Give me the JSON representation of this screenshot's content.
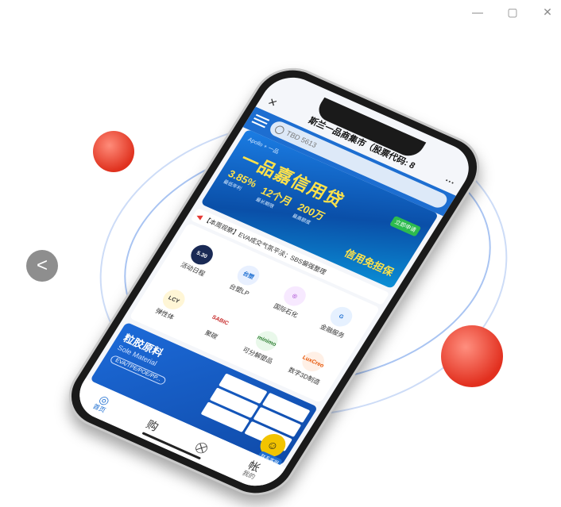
{
  "window": {
    "minimize": "—",
    "maximize": "▢",
    "close": "✕"
  },
  "carousel": {
    "prev_label": "<"
  },
  "app": {
    "title": "斯兰一品商集市（股票代码: 8",
    "close": "✕",
    "more": "···",
    "search_placeholder": "TBD 5613",
    "banner": {
      "small": "Apollo + 一品",
      "title": "一品嘉信用贷",
      "tag": "立即申请",
      "rates": [
        {
          "value": "3.85%",
          "caption": "最低年利"
        },
        {
          "value": "12个月",
          "caption": "最长期限"
        },
        {
          "value": "200万",
          "caption": "最高额度"
        }
      ],
      "foot": "信用免担保"
    },
    "notice": "【本周观察】EVA成交气氛平淡；SBS偏强整理",
    "grid": [
      {
        "label": "活动日程",
        "logo": "5.30",
        "color": "#1a2a55",
        "fg": "#ffffff"
      },
      {
        "label": "台塑LP",
        "logo": "台塑",
        "color": "#e8f0ff",
        "fg": "#1d6ed1"
      },
      {
        "label": "国际石化",
        "logo": "◎",
        "color": "#f7e9ff",
        "fg": "#9b30c8"
      },
      {
        "label": "金融服务",
        "logo": "G",
        "color": "#e6f1ff",
        "fg": "#1d6ed1"
      },
      {
        "label": "弹性体",
        "logo": "LCY",
        "color": "#fff6d6",
        "fg": "#333333"
      },
      {
        "label": "聚碳",
        "logo": "SABIC",
        "color": "#ffffff",
        "fg": "#c62828"
      },
      {
        "label": "可分解塑品",
        "logo": "minimo",
        "color": "#e9f8ea",
        "fg": "#2e7d32"
      },
      {
        "label": "数字3D制造",
        "logo": "LuxCreo",
        "color": "#fff0e6",
        "fg": "#e65100"
      }
    ],
    "promo": {
      "cn": "粒胶原料",
      "en": "Sole Material",
      "tags": "EVA/TPE/POE/PP..."
    },
    "tabs": [
      {
        "label": "首页",
        "icon": "◎"
      },
      {
        "label": "",
        "icon": "购"
      },
      {
        "label": "",
        "icon": "⛒"
      },
      {
        "label": "我的",
        "icon": "帐"
      }
    ],
    "avatar_label": "联系客服"
  }
}
